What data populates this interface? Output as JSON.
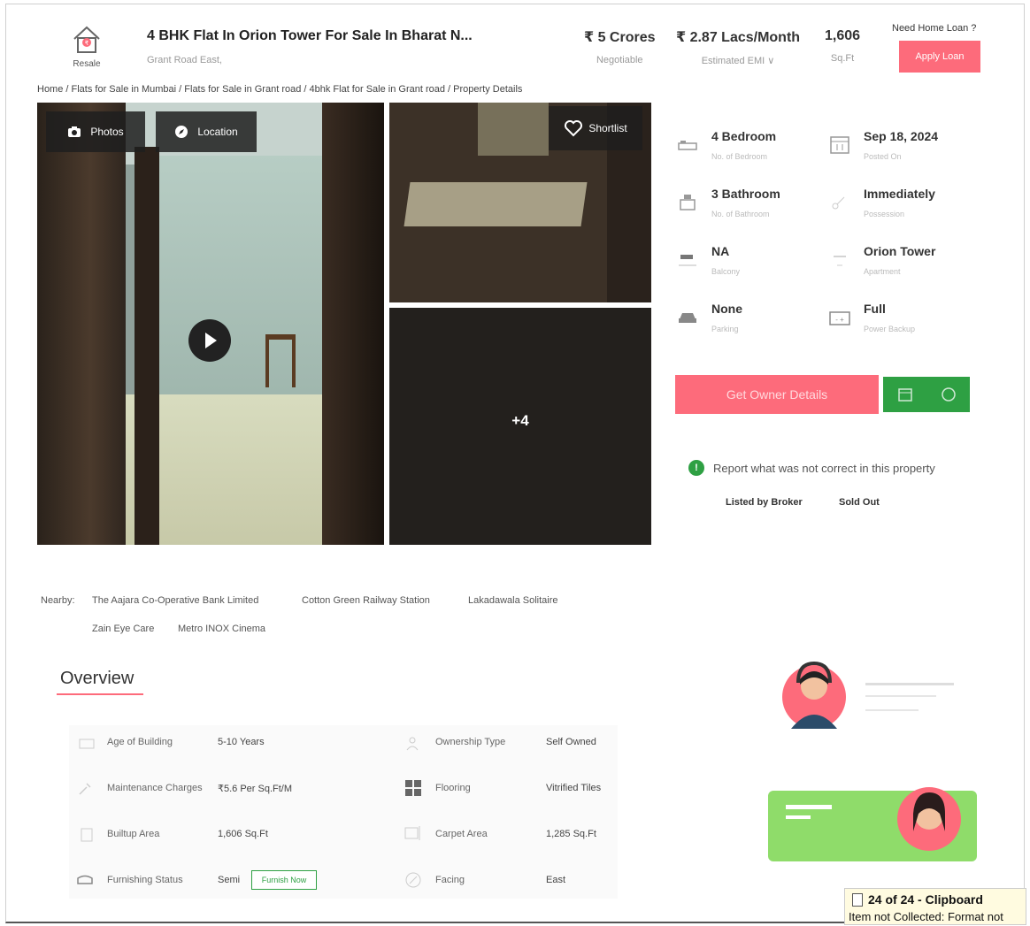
{
  "header": {
    "resale_label": "Resale",
    "title": "4 BHK Flat In Orion Tower For Sale In Bharat N...",
    "location": "Grant Road East,",
    "price": "₹ 5 Crores",
    "price_sub": "Negotiable",
    "emi": "₹ 2.87 Lacs/Month",
    "emi_sub": "Estimated EMI ∨",
    "area": "1,606",
    "area_sub": "Sq.Ft",
    "loan_question": "Need Home Loan ?",
    "apply_label": "Apply Loan"
  },
  "breadcrumb": "Home / Flats for Sale in Mumbai / Flats for Sale in Grant road / 4bhk Flat for Sale in Grant road / Property Details",
  "gallery": {
    "photos_label": "Photos",
    "location_label": "Location",
    "shortlist_label": "Shortlist",
    "more_count": "+4"
  },
  "specs": {
    "bedroom": {
      "value": "4 Bedroom",
      "sub": "No. of Bedroom"
    },
    "posted": {
      "value": "Sep 18, 2024",
      "sub": "Posted On"
    },
    "bathroom": {
      "value": "3 Bathroom",
      "sub": "No. of Bathroom"
    },
    "possession": {
      "value": "Immediately",
      "sub": "Possession"
    },
    "balcony": {
      "value": "NA",
      "sub": "Balcony"
    },
    "apartment": {
      "value": "Orion Tower",
      "sub": "Apartment"
    },
    "parking": {
      "value": "None",
      "sub": "Parking"
    },
    "power": {
      "value": "Full",
      "sub": "Power Backup"
    }
  },
  "actions": {
    "owner_label": "Get Owner Details",
    "report_label": "Report what was not correct in this property",
    "listed_by": "Listed by Broker",
    "status": "Sold Out"
  },
  "nearby": {
    "label": "Nearby:",
    "items": [
      "The Aajara Co-Operative Bank Limited",
      "Cotton Green Railway Station",
      "Lakadawala Solitaire",
      "Zain Eye Care",
      "Metro INOX Cinema"
    ]
  },
  "overview": {
    "title": "Overview",
    "age_k": "Age of Building",
    "age_v": "5-10 Years",
    "own_k": "Ownership Type",
    "own_v": "Self Owned",
    "maint_k": "Maintenance Charges",
    "maint_v": "₹5.6 Per Sq.Ft/M",
    "floor_k": "Flooring",
    "floor_v": "Vitrified Tiles",
    "built_k": "Builtup Area",
    "built_v": "1,606 Sq.Ft",
    "carpet_k": "Carpet Area",
    "carpet_v": "1,285 Sq.Ft",
    "furn_k": "Furnishing Status",
    "furn_v": "Semi",
    "furnish_btn": "Furnish Now",
    "facing_k": "Facing",
    "facing_v": "East"
  },
  "clipboard": {
    "title": "24 of 24 - Clipboard",
    "message": "Item not Collected: Format not"
  },
  "colors": {
    "accent": "#fd6b7b",
    "green": "#2ea043"
  }
}
